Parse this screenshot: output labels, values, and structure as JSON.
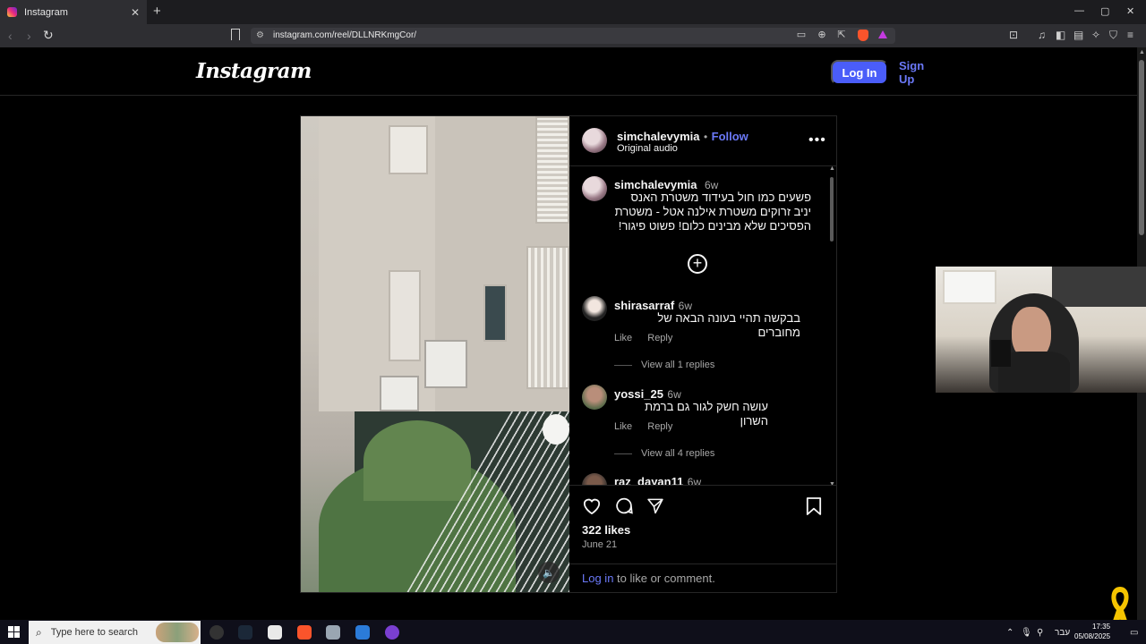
{
  "browser": {
    "tab_title": "Instagram",
    "tab_close": "✕",
    "new_tab": "+",
    "url": "instagram.com/reel/DLLNRKmgCor/",
    "win_min": "—",
    "win_max": "▢",
    "win_close": "✕"
  },
  "header": {
    "logo": "Instagram",
    "login": "Log In",
    "signup": "Sign Up"
  },
  "post": {
    "username": "simchalevymia",
    "separator": "•",
    "follow": "Follow",
    "audio": "Original audio",
    "more": "•••",
    "caption": {
      "username": "simchalevymia",
      "time": "6w",
      "text": "פשעים כמו חול בעידוד משטרת האנס יניב זרוקים משטרת אילנה אטל - משטרת הפסיכים שלא מבינים כלום! פשוט פיגור!"
    },
    "comments": [
      {
        "username": "shirasarraf",
        "time": "6w",
        "text": "בבקשה תהיי בעונה הבאה של מחוברים",
        "like": "Like",
        "reply": "Reply",
        "view_replies": "View all 1 replies"
      },
      {
        "username": "yossi_25",
        "time": "6w",
        "text": "עושה חשק לגור גם ברמת השרון",
        "like": "Like",
        "reply": "Reply",
        "view_replies": "View all 4 replies"
      },
      {
        "username": "raz_dayan11",
        "time": "6w"
      }
    ],
    "likes": "322 likes",
    "date": "June 21",
    "login_link": "Log in",
    "login_suffix": " to like or comment."
  },
  "taskbar": {
    "search_placeholder": "Type here to search",
    "lang": "עבר",
    "time": "17:35",
    "date": "05/08/2025"
  },
  "colors": {
    "accent": "#4a5df9",
    "link": "#6b79f8"
  }
}
